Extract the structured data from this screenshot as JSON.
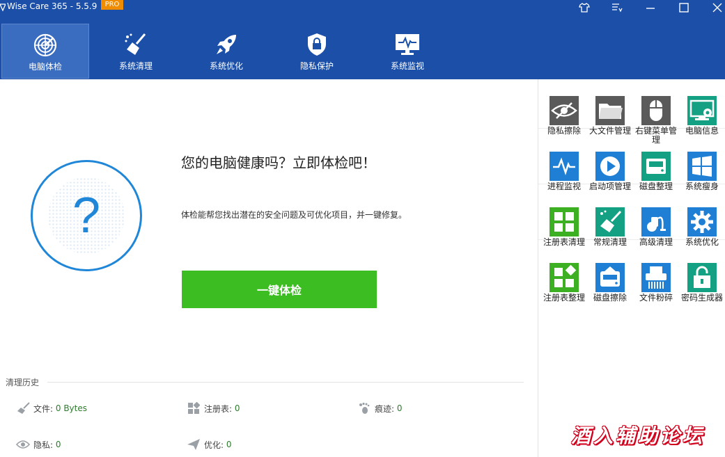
{
  "window": {
    "title": "Wise Care 365 - 5.5.9",
    "badge": "PRO"
  },
  "nav": {
    "tabs": [
      {
        "label": "电脑体检",
        "icon": "radar-icon",
        "active": true
      },
      {
        "label": "系统清理",
        "icon": "broom-icon",
        "active": false
      },
      {
        "label": "系统优化",
        "icon": "rocket-icon",
        "active": false
      },
      {
        "label": "隐私保护",
        "icon": "shield-lock-icon",
        "active": false
      },
      {
        "label": "系统监视",
        "icon": "monitor-pulse-icon",
        "active": false
      }
    ]
  },
  "main": {
    "headline": "您的电脑健康吗？立即体检吧！",
    "subtext": "体检能帮您找出潜在的安全问题及可优化项目，并一键修复。",
    "check_button": "一键体检",
    "status_symbol": "?"
  },
  "history": {
    "title": "清理历史",
    "items": [
      {
        "label": "文件:",
        "value": "0 Bytes",
        "icon": "broom-icon"
      },
      {
        "label": "注册表:",
        "value": "0",
        "icon": "blocks-icon"
      },
      {
        "label": "痕迹:",
        "value": "0",
        "icon": "footprint-icon"
      },
      {
        "label": "隐私:",
        "value": "0",
        "icon": "eye-icon"
      },
      {
        "label": "优化:",
        "value": "0",
        "icon": "paper-plane-icon"
      }
    ]
  },
  "tools": [
    {
      "label": "隐私擦除",
      "icon": "eye-slash-icon",
      "color": "#5a5a5a"
    },
    {
      "label": "大文件管理",
      "icon": "folder-icon",
      "color": "#5a5a5a"
    },
    {
      "label": "右键菜单管理",
      "icon": "mouse-icon",
      "color": "#5a5a5a"
    },
    {
      "label": "电脑信息",
      "icon": "monitor-gear-icon",
      "color": "#14a083"
    },
    {
      "label": "进程监视",
      "icon": "pulse-icon",
      "color": "#1e7fd4"
    },
    {
      "label": "启动项管理",
      "icon": "play-icon",
      "color": "#1e7fd4"
    },
    {
      "label": "磁盘整理",
      "icon": "disk-icon",
      "color": "#14a083"
    },
    {
      "label": "系统瘦身",
      "icon": "windows-icon",
      "color": "#1e7fd4"
    },
    {
      "label": "注册表清理",
      "icon": "grid-icon",
      "color": "#3cb022"
    },
    {
      "label": "常规清理",
      "icon": "broom-icon",
      "color": "#14a083"
    },
    {
      "label": "高级清理",
      "icon": "vacuum-icon",
      "color": "#1e7fd4"
    },
    {
      "label": "系统优化",
      "icon": "gear-icon",
      "color": "#1e7fd4"
    },
    {
      "label": "注册表整理",
      "icon": "grid-diamond-icon",
      "color": "#3cb022"
    },
    {
      "label": "磁盘擦除",
      "icon": "disk-eraser-icon",
      "color": "#1e7fd4"
    },
    {
      "label": "文件粉碎",
      "icon": "shredder-icon",
      "color": "#1e7fd4"
    },
    {
      "label": "密码生成器",
      "icon": "padlock-icon",
      "color": "#14a083"
    }
  ],
  "watermark": "酒入辅助论坛"
}
